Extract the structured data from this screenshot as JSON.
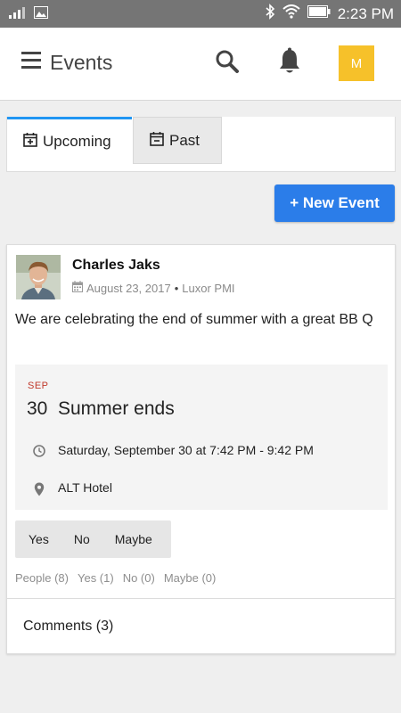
{
  "status_bar": {
    "time": "2:23 PM",
    "icons": [
      "signal-icon",
      "image-icon",
      "bluetooth-icon",
      "wifi-icon",
      "battery-icon"
    ]
  },
  "app_bar": {
    "title": "Events",
    "avatar_initial": "M",
    "avatar_color": "#f6c12a",
    "icons": [
      "menu-icon",
      "search-icon",
      "bell-icon"
    ]
  },
  "tabs": [
    {
      "label": "Upcoming",
      "icon": "calendar-plus-icon",
      "active": true
    },
    {
      "label": "Past",
      "icon": "calendar-minus-icon",
      "active": false
    }
  ],
  "new_event_label": "+ New Event",
  "accent_color": "#2b7de9",
  "post": {
    "author": "Charles Jaks",
    "date": "August 23, 2017",
    "separator": "•",
    "group": "Luxor PMI",
    "text": "We are celebrating the end of summer with a great BB Q",
    "event": {
      "month": "SEP",
      "day": "30",
      "title": "Summer ends",
      "time": "Saturday, September 30 at 7:42 PM - 9:42 PM",
      "location": "ALT Hotel"
    },
    "rsvp": [
      "Yes",
      "No",
      "Maybe"
    ],
    "counts": {
      "people": "People (8)",
      "yes": "Yes (1)",
      "no": "No (0)",
      "maybe": "Maybe (0)"
    },
    "comments_label": "Comments (3)"
  }
}
